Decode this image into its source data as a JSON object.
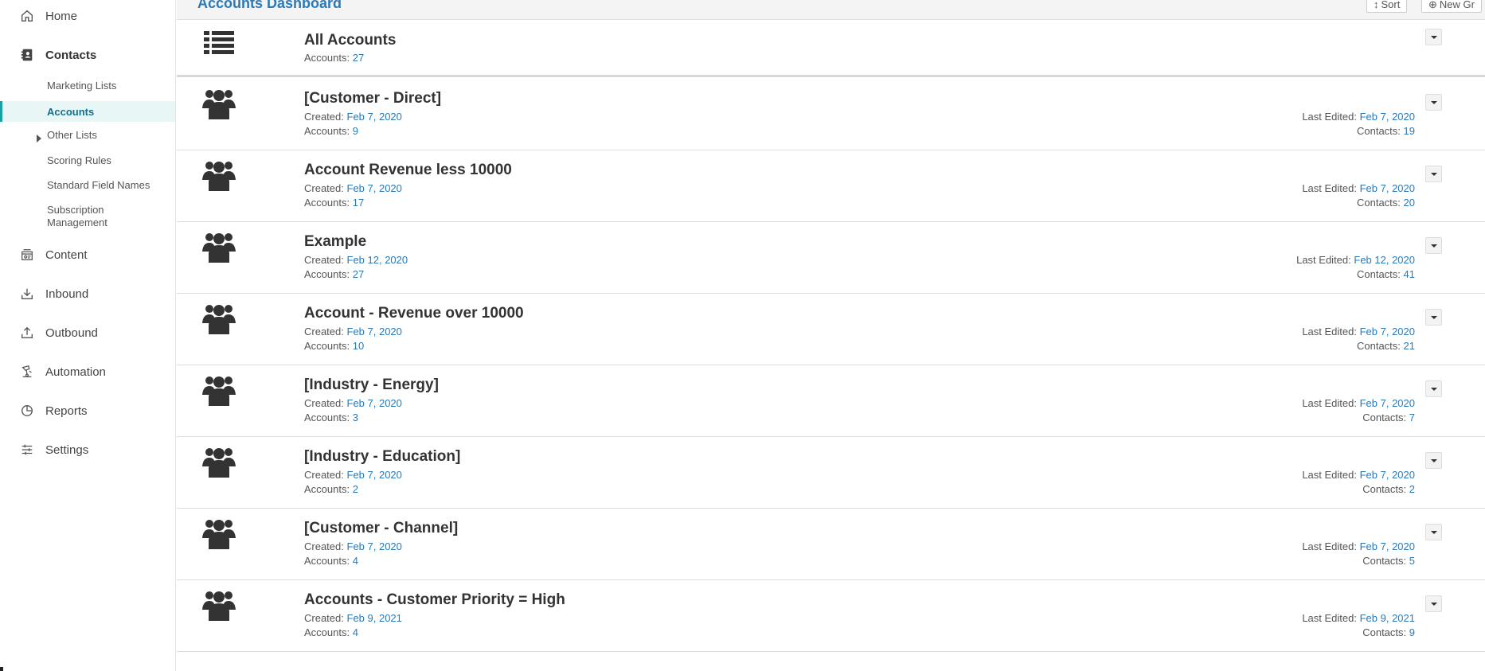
{
  "sidebar": {
    "nav": [
      {
        "label": "Home",
        "icon": "home-icon"
      },
      {
        "label": "Contacts",
        "icon": "contacts-icon"
      },
      {
        "label": "Content",
        "icon": "content-icon"
      },
      {
        "label": "Inbound",
        "icon": "inbound-icon"
      },
      {
        "label": "Outbound",
        "icon": "outbound-icon"
      },
      {
        "label": "Automation",
        "icon": "automation-icon"
      },
      {
        "label": "Reports",
        "icon": "reports-icon"
      },
      {
        "label": "Settings",
        "icon": "settings-icon"
      }
    ],
    "contacts_sub": [
      {
        "label": "Marketing Lists"
      },
      {
        "label": "Accounts"
      },
      {
        "label": "Other Lists"
      },
      {
        "label": "Scoring Rules"
      },
      {
        "label": "Standard Field Names"
      },
      {
        "label": "Subscription Management"
      }
    ]
  },
  "header": {
    "title": "Accounts Dashboard",
    "sort_label": "Sort",
    "new_label": "New Gr"
  },
  "all_accounts": {
    "name": "All Accounts",
    "accounts_label": "Accounts:",
    "accounts": "27"
  },
  "labels": {
    "created": "Created:",
    "accounts": "Accounts:",
    "last_edited": "Last Edited:",
    "contacts": "Contacts:"
  },
  "groups": [
    {
      "name": "[Customer - Direct]",
      "created": "Feb 7, 2020",
      "accounts": "9",
      "last_edited": "Feb 7, 2020",
      "contacts": "19"
    },
    {
      "name": "Account Revenue less 10000",
      "created": "Feb 7, 2020",
      "accounts": "17",
      "last_edited": "Feb 7, 2020",
      "contacts": "20"
    },
    {
      "name": "Example",
      "created": "Feb 12, 2020",
      "accounts": "27",
      "last_edited": "Feb 12, 2020",
      "contacts": "41"
    },
    {
      "name": "Account - Revenue over 10000",
      "created": "Feb 7, 2020",
      "accounts": "10",
      "last_edited": "Feb 7, 2020",
      "contacts": "21"
    },
    {
      "name": "[Industry - Energy]",
      "created": "Feb 7, 2020",
      "accounts": "3",
      "last_edited": "Feb 7, 2020",
      "contacts": "7"
    },
    {
      "name": "[Industry - Education]",
      "created": "Feb 7, 2020",
      "accounts": "2",
      "last_edited": "Feb 7, 2020",
      "contacts": "2"
    },
    {
      "name": "[Customer - Channel]",
      "created": "Feb 7, 2020",
      "accounts": "4",
      "last_edited": "Feb 7, 2020",
      "contacts": "5"
    },
    {
      "name": "Accounts - Customer Priority = High",
      "created": "Feb 9, 2021",
      "accounts": "4",
      "last_edited": "Feb 9, 2021",
      "contacts": "9"
    }
  ]
}
